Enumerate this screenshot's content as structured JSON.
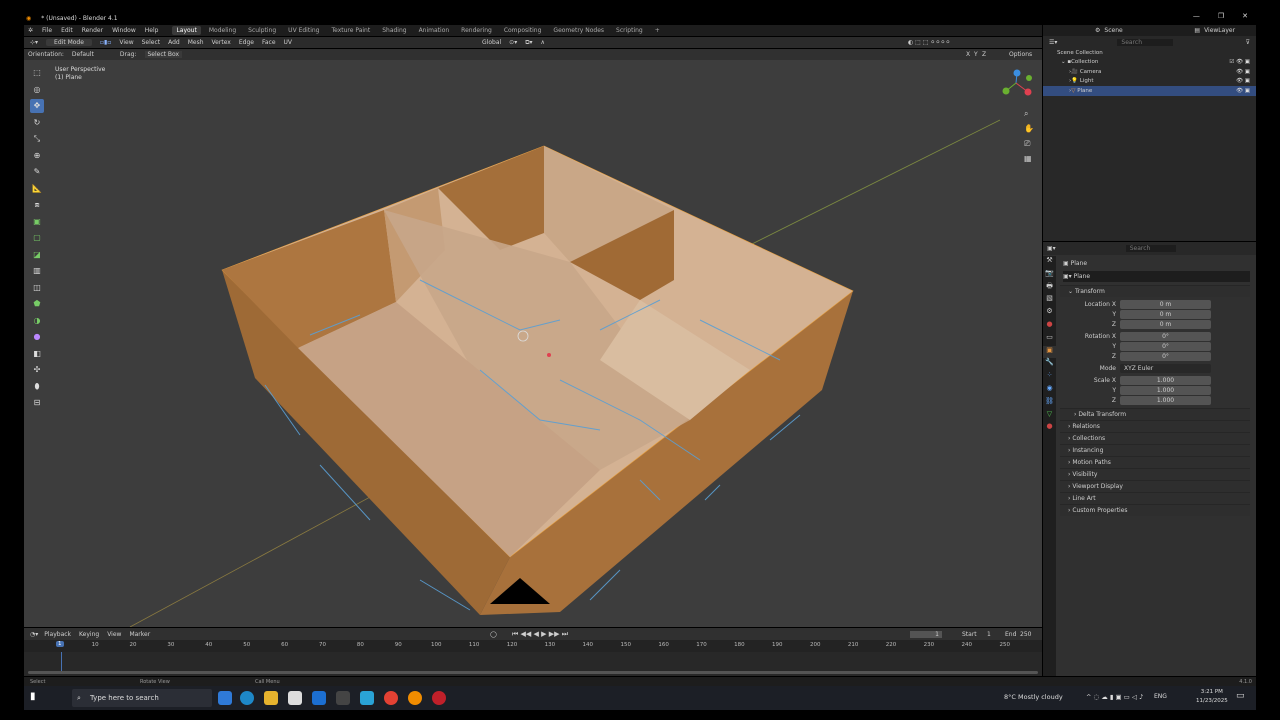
{
  "window": {
    "title": "* (Unsaved) - Blender 4.1",
    "controls": [
      "—",
      "❐",
      "✕"
    ]
  },
  "menu": {
    "items": [
      "File",
      "Edit",
      "Render",
      "Window",
      "Help"
    ],
    "workspaces": [
      "Layout",
      "Modeling",
      "Sculpting",
      "UV Editing",
      "Texture Paint",
      "Shading",
      "Animation",
      "Rendering",
      "Compositing",
      "Geometry Nodes",
      "Scripting",
      "+"
    ],
    "active_workspace": "Layout"
  },
  "header": {
    "mode": "Edit Mode",
    "menus": [
      "View",
      "Select",
      "Add",
      "Mesh",
      "Vertex",
      "Edge",
      "Face",
      "UV"
    ],
    "transform_orientation": "Global"
  },
  "options_row": {
    "orientation_label": "Orientation:",
    "orientation_value": "Default",
    "drag_label": "Drag:",
    "drag_value": "Select Box",
    "axes": [
      "X",
      "Y",
      "Z"
    ],
    "options": "Options"
  },
  "viewport": {
    "perspective": "User Perspective",
    "object": "(1) Plane"
  },
  "scene": {
    "scene_label": "Scene",
    "view_layer": "ViewLayer"
  },
  "outliner": {
    "search_placeholder": "Search",
    "rows": [
      {
        "label": "Scene Collection",
        "indent": 0
      },
      {
        "label": "Collection",
        "indent": 1
      },
      {
        "label": "Camera",
        "indent": 2
      },
      {
        "label": "Light",
        "indent": 2
      },
      {
        "label": "Plane",
        "indent": 2,
        "selected": true
      }
    ]
  },
  "properties": {
    "search_placeholder": "Search",
    "object_name": "Plane",
    "data_name": "Plane",
    "transform_title": "Transform",
    "location": {
      "label": "Location X",
      "values": [
        "0 m",
        "0 m",
        "0 m"
      ]
    },
    "rotation": {
      "label": "Rotation X",
      "values": [
        "0°",
        "0°",
        "0°"
      ]
    },
    "mode_label": "Mode",
    "mode_value": "XYZ Euler",
    "scale": {
      "label": "Scale X",
      "values": [
        "1.000",
        "1.000",
        "1.000"
      ]
    },
    "axis_y": "Y",
    "axis_z": "Z",
    "delta": "Delta Transform",
    "panels": [
      "Relations",
      "Collections",
      "Instancing",
      "Motion Paths",
      "Visibility",
      "Viewport Display",
      "Line Art",
      "Custom Properties"
    ]
  },
  "timeline": {
    "menus": [
      "Playback",
      "Keying",
      "View",
      "Marker"
    ],
    "current_frame": "1",
    "start_label": "Start",
    "start": "1",
    "end_label": "End",
    "end": "250",
    "ticks": [
      "10",
      "20",
      "30",
      "40",
      "50",
      "60",
      "70",
      "80",
      "90",
      "100",
      "110",
      "120",
      "130",
      "140",
      "150",
      "160",
      "170",
      "180",
      "190",
      "200",
      "210",
      "220",
      "230",
      "240",
      "250"
    ],
    "playhead": "1"
  },
  "status": {
    "items": [
      "Select",
      "Rotate View",
      "Call Menu"
    ],
    "version": "4.1.0"
  },
  "taskbar": {
    "search_placeholder": "Type here to search",
    "weather": "8°C  Mostly cloudy",
    "lang": "ENG",
    "time": "3:21 PM",
    "date": "11/23/2025"
  },
  "colors": {
    "accent": "#4772b3",
    "wall": "#b07a45",
    "face": "#d6b495",
    "viewport": "#3d3d3d"
  }
}
